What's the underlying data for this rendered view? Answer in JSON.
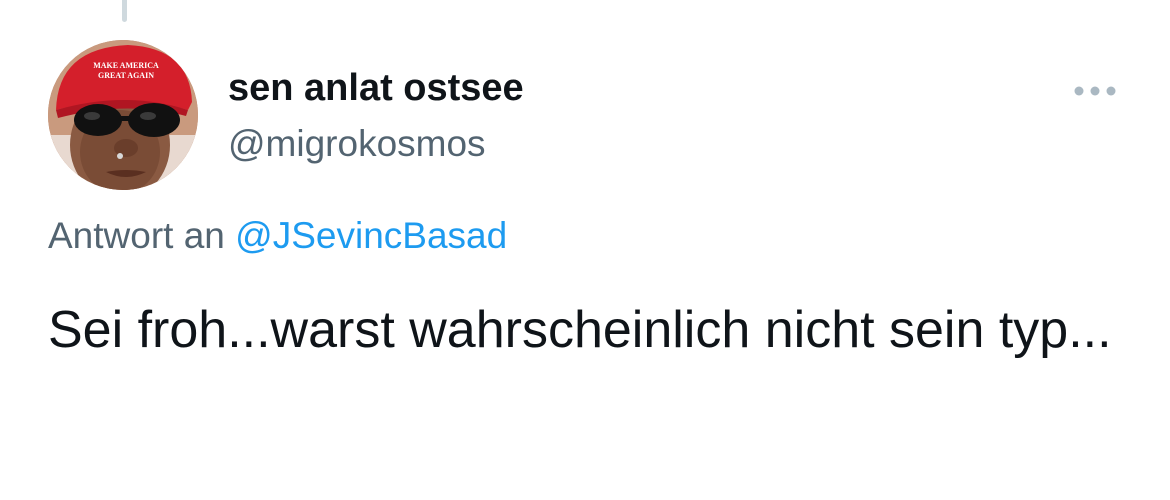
{
  "tweet": {
    "author": {
      "display_name": "sen anlat ostsee",
      "handle": "@migrokosmos",
      "avatar_cap_text_line1": "MAKE AMERICA",
      "avatar_cap_text_line2": "GREAT AGAIN"
    },
    "reply_to": {
      "prefix": "Antwort an ",
      "mention": "@JSevincBasad"
    },
    "text": "Sei froh...warst wahrscheinlich nicht sein typ..."
  },
  "icons": {
    "more": "more-horizontal-icon"
  },
  "colors": {
    "text_primary": "#0f1419",
    "text_secondary": "#536471",
    "link": "#1d9bf0",
    "thread_line": "#cfd9de"
  }
}
